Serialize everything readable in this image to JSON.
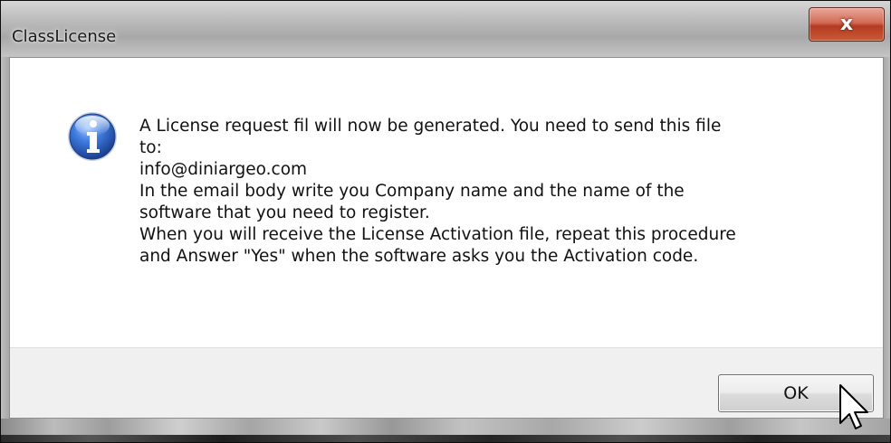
{
  "window": {
    "title": "ClassLicense",
    "close_glyph": "x"
  },
  "message": {
    "icon": "info-icon",
    "lines": [
      "A License request fil will now be generated. You need to send this file",
      "to:",
      "info@diniargeo.com",
      "In the email body write you Company name and the name of the",
      "software that you need to register.",
      "When you will receive the License Activation file, repeat this procedure",
      "and Answer \"Yes\" when the software asks you the Activation code."
    ]
  },
  "buttons": {
    "ok_label": "OK"
  },
  "colors": {
    "info_icon_blue": "#2a63c9",
    "close_button_red": "#c94a30"
  }
}
